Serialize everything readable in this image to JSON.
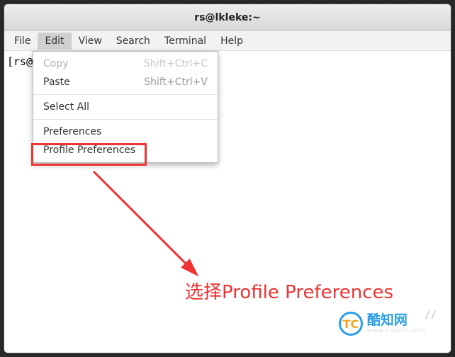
{
  "window": {
    "title": "rs@lkleke:~"
  },
  "menubar": {
    "file": "File",
    "edit": "Edit",
    "view": "View",
    "search": "Search",
    "terminal": "Terminal",
    "help": "Help"
  },
  "prompt": "[rs@l",
  "dropdown": {
    "copy": {
      "label": "Copy",
      "shortcut": "Shift+Ctrl+C"
    },
    "paste": {
      "label": "Paste",
      "shortcut": "Shift+Ctrl+V"
    },
    "select_all": {
      "label": "Select All"
    },
    "preferences": {
      "label": "Preferences"
    },
    "profile_prefs": {
      "label": "Profile Preferences"
    }
  },
  "annotation": {
    "text": "选择Profile Preferences"
  },
  "logo": {
    "text": "TC",
    "title": "酷知网",
    "subtitle": "www.coozhi.com"
  },
  "slashes": "//"
}
